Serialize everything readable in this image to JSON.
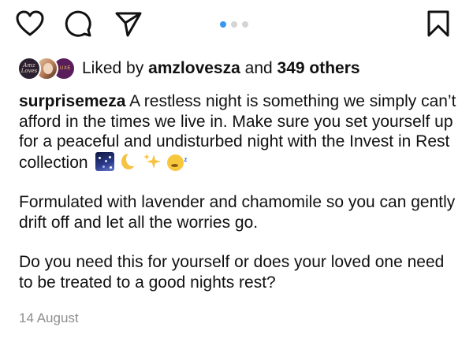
{
  "actions": {
    "like": "heart-icon",
    "comment": "comment-icon",
    "share": "share-icon",
    "save": "bookmark-icon"
  },
  "carousel": {
    "total": 3,
    "active_index": 1
  },
  "likes": {
    "prefix": "Liked by",
    "user": "amzlovesza",
    "conjunction": "and",
    "others": "349 others",
    "avatar_1_text": "Amz Loves",
    "avatar_3_text": "LUXE"
  },
  "caption": {
    "username": "surprisemeza",
    "line1": "A restless night is something we simply can’t afford in the times we live in. Make sure you set yourself up for a peaceful and undisturbed night with the Invest in Rest collection",
    "emojis": [
      "night-sky-emoji",
      "crescent-moon-emoji",
      "sparkles-emoji",
      "sleeping-face-emoji"
    ],
    "paragraph2": "Formulated with lavender and chamomile so you can gently drift off and let all the worries go.",
    "paragraph3": "Do you need this for yourself or does your loved one need to be treated to a good nights rest?"
  },
  "date": "14 August",
  "colors": {
    "accent": "#3897f0",
    "muted": "#8e8e8e",
    "text": "#111111"
  }
}
